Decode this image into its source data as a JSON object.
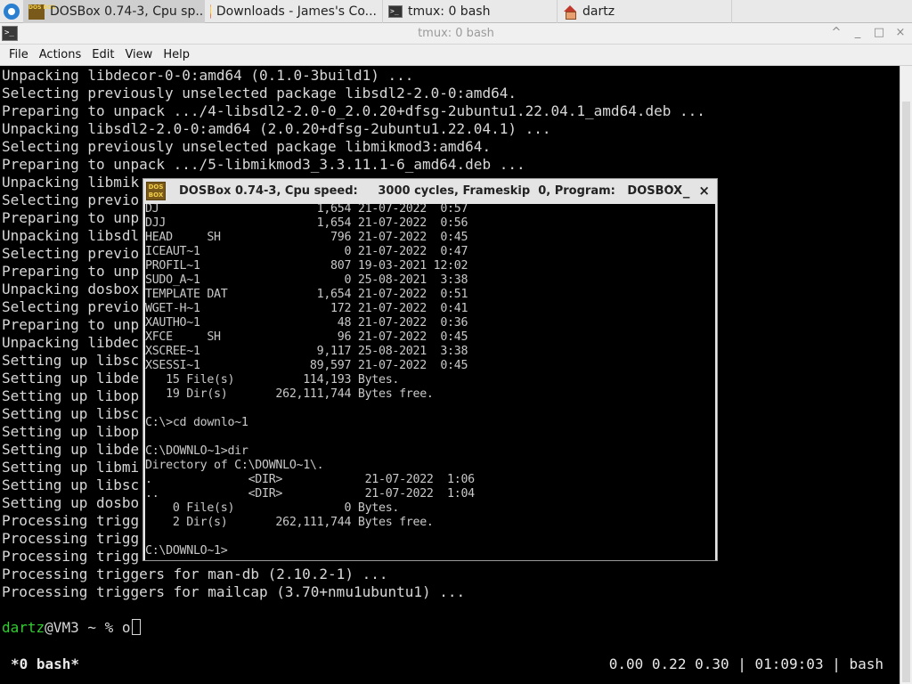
{
  "taskbar": {
    "tasks": [
      {
        "label": "DOSBox 0.74-3, Cpu sp...",
        "icon": "dosbox-icon"
      },
      {
        "label": "Downloads - James's Co...",
        "icon": "firefox-icon"
      },
      {
        "label": "tmux: 0 bash",
        "icon": "terminal-icon"
      },
      {
        "label": "dartz",
        "icon": "home-folder-icon"
      }
    ]
  },
  "window": {
    "title": "tmux: 0 bash",
    "controls": [
      "^",
      "_",
      "□",
      "×"
    ]
  },
  "menu": [
    "File",
    "Actions",
    "Edit",
    "View",
    "Help"
  ],
  "terminal": {
    "lines": [
      "Unpacking libdecor-0-0:amd64 (0.1.0-3build1) ...",
      "Selecting previously unselected package libsdl2-2.0-0:amd64.",
      "Preparing to unpack .../4-libsdl2-2.0-0_2.0.20+dfsg-2ubuntu1.22.04.1_amd64.deb ...",
      "Unpacking libsdl2-2.0-0:amd64 (2.0.20+dfsg-2ubuntu1.22.04.1) ...",
      "Selecting previously unselected package libmikmod3:amd64.",
      "Preparing to unpack .../5-libmikmod3_3.3.11.1-6_amd64.deb ...",
      "Unpacking libmik",
      "Selecting previo",
      "Preparing to unp",
      "Unpacking libsdl",
      "Selecting previo",
      "Preparing to unp",
      "Unpacking dosbox",
      "Selecting previo",
      "Preparing to unp",
      "Unpacking libdec",
      "Setting up libsc",
      "Setting up libde",
      "Setting up libop",
      "Setting up libsc",
      "Setting up libop",
      "Setting up libde",
      "Setting up libmi",
      "Setting up libsc",
      "Setting up dosbo",
      "Processing trigg",
      "Processing trigg",
      "Processing trigg",
      "Processing triggers for man-db (2.10.2-1) ...",
      "Processing triggers for mailcap (3.70+nmu1ubuntu1) ..."
    ],
    "prompt_user": "dartz",
    "prompt_rest": "@VM3 ~ % o",
    "status_left": "*0 bash*",
    "status_right": "0.00 0.22 0.30 | 01:09:03 | bash"
  },
  "dosbox": {
    "icon_text": "DOS BOX",
    "title": "DOSBox 0.74-3, Cpu speed:     3000 cycles, Frameskip  0, Program:   DOSBOX",
    "controls": [
      "^",
      "_",
      "×"
    ],
    "lines": [
      "DJ                       1,654 21-07-2022  0:57",
      "DJJ                      1,654 21-07-2022  0:56",
      "HEAD     SH                796 21-07-2022  0:45",
      "ICEAUT~1                     0 21-07-2022  0:47",
      "PROFIL~1                   807 19-03-2021 12:02",
      "SUDO_A~1                     0 25-08-2021  3:38",
      "TEMPLATE DAT             1,654 21-07-2022  0:51",
      "WGET-H~1                   172 21-07-2022  0:41",
      "XAUTHO~1                    48 21-07-2022  0:36",
      "XFCE     SH                 96 21-07-2022  0:45",
      "XSCREE~1                 9,117 25-08-2021  3:38",
      "XSESSI~1                89,597 21-07-2022  0:45",
      "   15 File(s)          114,193 Bytes.",
      "   19 Dir(s)       262,111,744 Bytes free.",
      "",
      "C:\\>cd downlo~1",
      "",
      "C:\\DOWNLO~1>dir",
      "Directory of C:\\DOWNLO~1\\.",
      ".              <DIR>            21-07-2022  1:06",
      "..             <DIR>            21-07-2022  1:04",
      "    0 File(s)                0 Bytes.",
      "    2 Dir(s)       262,111,744 Bytes free.",
      "",
      "C:\\DOWNLO~1>"
    ]
  }
}
